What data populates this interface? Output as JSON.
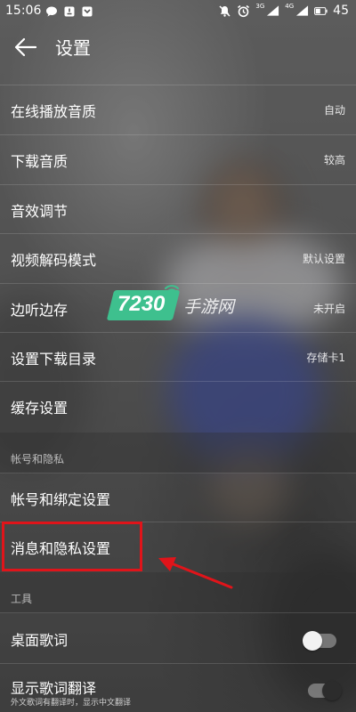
{
  "status_bar": {
    "time": "15:06",
    "signal_tag_1": "3G",
    "signal_tag_2": "4G",
    "battery": "45"
  },
  "header": {
    "title": "设置"
  },
  "settings": {
    "online_quality": {
      "label": "在线播放音质",
      "value": "自动"
    },
    "download_quality": {
      "label": "下载音质",
      "value": "较高"
    },
    "sound_effect": {
      "label": "音效调节"
    },
    "video_decode": {
      "label": "视频解码模式",
      "value": "默认设置"
    },
    "listen_cache": {
      "label": "边听边存",
      "value": "未开启"
    },
    "download_dir": {
      "label": "设置下载目录",
      "value": "存储卡1"
    },
    "cache_settings": {
      "label": "缓存设置"
    }
  },
  "section_account": {
    "header": "帐号和隐私",
    "account_binding": {
      "label": "帐号和绑定设置"
    },
    "message_privacy": {
      "label": "消息和隐私设置"
    }
  },
  "section_tools": {
    "header": "工具",
    "desktop_lyrics": {
      "label": "桌面歌词",
      "enabled": false
    },
    "lyrics_translation": {
      "label": "显示歌词翻译",
      "sublabel": "外文歌词有翻译时，显示中文翻译",
      "enabled": true
    }
  },
  "watermark": {
    "number": "7230",
    "text": "手游网"
  },
  "colors": {
    "highlight": "#e0141a",
    "watermark_green": "#3ec08e"
  }
}
